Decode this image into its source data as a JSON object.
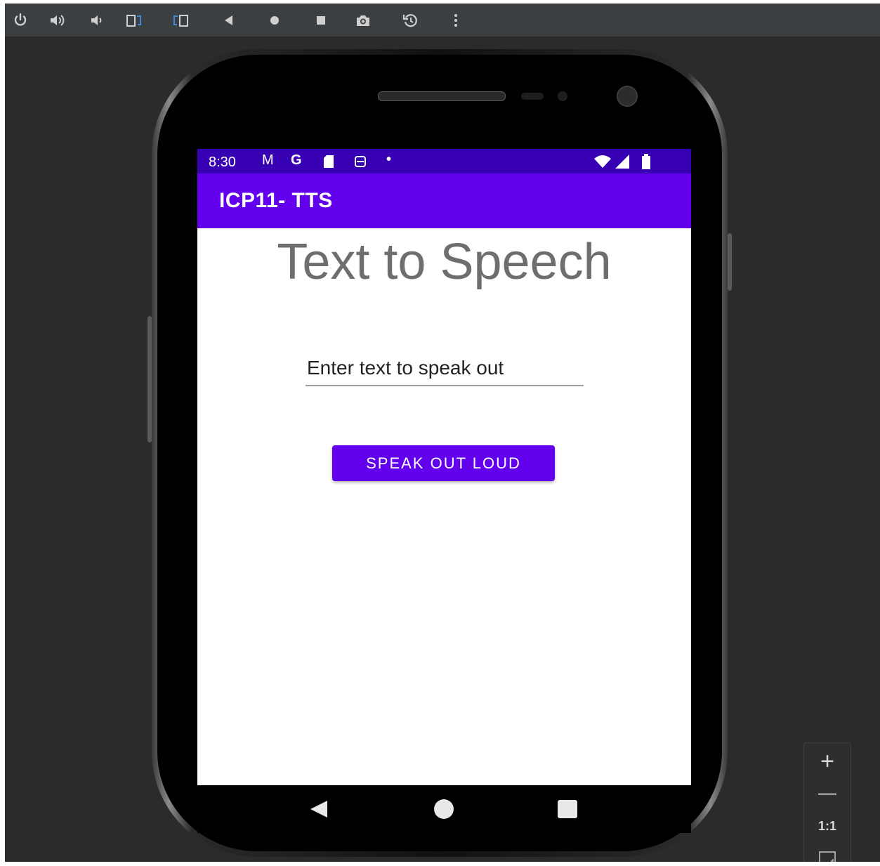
{
  "toolbar": {
    "icons": [
      "power-icon",
      "volume-up-icon",
      "volume-down-icon",
      "rotate-left-icon",
      "rotate-right-icon",
      "back-icon",
      "home-icon",
      "overview-icon",
      "camera-icon",
      "snapshot-icon",
      "more-icon"
    ]
  },
  "statusbar": {
    "time": "8:30",
    "gmail_glyph": "M",
    "google_glyph": "G",
    "notification_dot": "•"
  },
  "app": {
    "title": "ICP11- TTS",
    "heading": "Text to Speech",
    "input_placeholder": "Enter text to speak out",
    "input_value": "",
    "button_label": "SPEAK OUT LOUD"
  },
  "zoom_panel": {
    "zoom_in": "+",
    "zoom_out": "—",
    "actual_size": "1:1"
  },
  "colors": {
    "status_bar": "#3700b3",
    "app_bar": "#6200ee",
    "button": "#6200ee",
    "emulator_bg": "#2b2b2b",
    "toolbar_bg": "#3c3f41"
  }
}
